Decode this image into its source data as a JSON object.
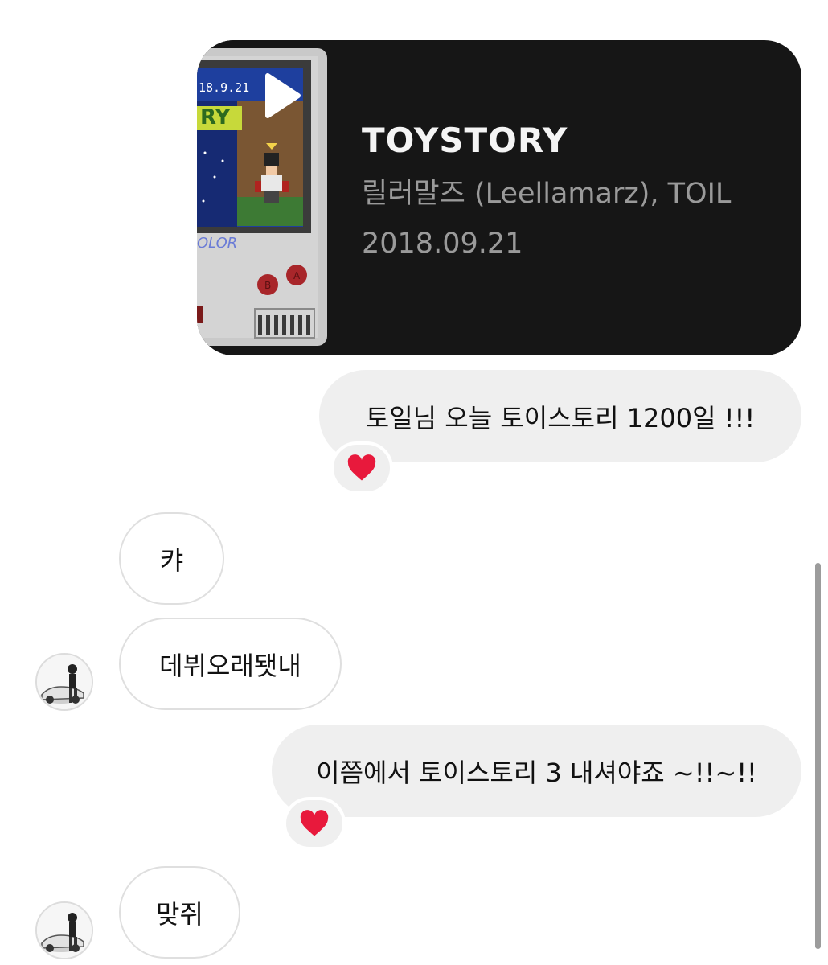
{
  "media_card": {
    "title": "TOYSTORY",
    "artist": "릴러말즈 (Leellamarz), TOIL",
    "date": "2018.09.21",
    "thumbnail": {
      "screen_date": "18.9.21",
      "screen_word": "RY",
      "brand": "OLOR",
      "button_a": "B",
      "button_b": "A"
    },
    "play_icon": "play-icon"
  },
  "messages": [
    {
      "id": "m1",
      "side": "sent",
      "text": "토일님 오늘 토이스토리 1200일 !!!",
      "reaction": "❤️"
    },
    {
      "id": "m2",
      "side": "received",
      "text": "캬"
    },
    {
      "id": "m3",
      "side": "received",
      "text": "데뷔오래됏내"
    },
    {
      "id": "m4",
      "side": "sent",
      "text": "이쯤에서 토이스토리 3 내셔야죠 ~!!~!!",
      "reaction": "❤️"
    },
    {
      "id": "m5",
      "side": "received",
      "text": "맞쥐"
    }
  ],
  "colors": {
    "sent_bubble": "#efefef",
    "received_bubble_border": "#dfdfdf",
    "media_card_bg": "#161616",
    "heart": "#e8193c"
  }
}
